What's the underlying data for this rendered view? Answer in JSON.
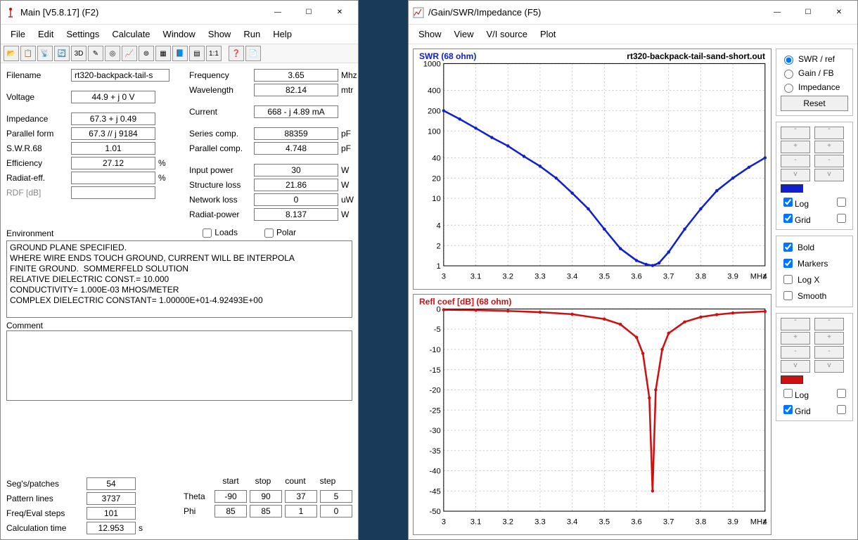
{
  "main": {
    "title": "Main  [V5.8.17]  (F2)",
    "icon": "antenna-icon",
    "winbtns": {
      "min": "—",
      "max": "☐",
      "close": "✕"
    },
    "menu": [
      "File",
      "Edit",
      "Settings",
      "Calculate",
      "Window",
      "Show",
      "Run",
      "Help"
    ],
    "toolbar_icons": [
      "open",
      "copy",
      "antenna",
      "refresh",
      "3d",
      "edit",
      "circle",
      "chart",
      "target",
      "mesh",
      "book",
      "grid",
      "ratio",
      "|",
      "help",
      "sheet"
    ],
    "filename_label": "Filename",
    "filename": "rt320-backpack-tail-s",
    "left_block": [
      {
        "label": "Voltage",
        "value": "44.9 + j 0 V",
        "unit": ""
      },
      {
        "label": "Impedance",
        "value": "67.3 + j 0.49",
        "unit": ""
      },
      {
        "label": "Parallel form",
        "value": "67.3 // j 9184",
        "unit": ""
      },
      {
        "label": "S.W.R.68",
        "value": "1.01",
        "unit": ""
      },
      {
        "label": "Efficiency",
        "value": "27.12",
        "unit": "%"
      },
      {
        "label": "Radiat-eff.",
        "value": "",
        "unit": "%"
      },
      {
        "label": "RDF [dB]",
        "value": "",
        "unit": "",
        "dim": true
      }
    ],
    "right_block": [
      {
        "label": "Frequency",
        "value": "3.65",
        "unit": "Mhz"
      },
      {
        "label": "Wavelength",
        "value": "82.14",
        "unit": "mtr"
      },
      {
        "label": "Current",
        "value": "668 - j 4.89 mA",
        "unit": ""
      },
      {
        "label": "Series comp.",
        "value": "88359",
        "unit": "pF"
      },
      {
        "label": "Parallel comp.",
        "value": "4.748",
        "unit": "pF"
      },
      {
        "label": "Input power",
        "value": "30",
        "unit": "W"
      },
      {
        "label": "Structure loss",
        "value": "21.86",
        "unit": "W"
      },
      {
        "label": "Network loss",
        "value": "0",
        "unit": "uW"
      },
      {
        "label": "Radiat-power",
        "value": "8.137",
        "unit": "W"
      }
    ],
    "checks": {
      "loads": "Loads",
      "polar": "Polar"
    },
    "env_label": "Environment",
    "environment": "GROUND PLANE SPECIFIED.\nWHERE WIRE ENDS TOUCH GROUND, CURRENT WILL BE INTERPOLA\nFINITE GROUND.  SOMMERFELD SOLUTION\nRELATIVE DIELECTRIC CONST.= 10.000\nCONDUCTIVITY= 1.000E-03 MHOS/METER\nCOMPLEX DIELECTRIC CONSTANT= 1.00000E+01-4.92493E+00",
    "comment_label": "Comment",
    "comment": "",
    "bottom_left": [
      {
        "label": "Seg's/patches",
        "value": "54"
      },
      {
        "label": "Pattern lines",
        "value": "3737"
      },
      {
        "label": "Freq/Eval steps",
        "value": "101"
      },
      {
        "label": "Calculation time",
        "value": "12.953",
        "unit": "s"
      }
    ],
    "bottom_hdr": [
      "start",
      "stop",
      "count",
      "step"
    ],
    "bottom_right": [
      {
        "label": "Theta",
        "vals": [
          "-90",
          "90",
          "37",
          "5"
        ]
      },
      {
        "label": "Phi",
        "vals": [
          "85",
          "85",
          "1",
          "0"
        ]
      }
    ]
  },
  "graph": {
    "title": "/Gain/SWR/Impedance (F5)",
    "icon": "chart-icon",
    "winbtns": {
      "min": "—",
      "max": "☐",
      "close": "✕"
    },
    "menu": [
      "Show",
      "View",
      "V/I source",
      "Plot"
    ],
    "file": "rt320-backpack-tail-sand-short.out",
    "swr_label": "SWR  (68 ohm)",
    "refl_label": "Refl coef [dB] (68 ohm)",
    "xunit": "MHz",
    "side": {
      "mode": {
        "swr": "SWR / ref",
        "gain": "Gain / FB",
        "imp": "Impedance",
        "selected": "swr"
      },
      "reset": "Reset",
      "spin_labels": [
        "ˆ",
        "+",
        "-",
        "v"
      ],
      "log": "Log",
      "grid": "Grid",
      "checks1": {
        "log": true,
        "grid": true,
        "log2": false,
        "grid2": false
      },
      "bold": "Bold",
      "markers": "Markers",
      "logx": "Log X",
      "smooth": "Smooth",
      "checks2": {
        "bold": true,
        "markers": true,
        "logx": false,
        "smooth": false
      },
      "checks3": {
        "log": false,
        "grid": true,
        "log2": false,
        "grid2": false
      }
    }
  },
  "chart_data": [
    {
      "type": "line",
      "title": "SWR (68 ohm)",
      "xlabel": "MHz",
      "ylabel": "SWR",
      "xlim": [
        3.0,
        4.0
      ],
      "ylim": [
        1,
        1000
      ],
      "yscale": "log",
      "x": [
        3.0,
        3.05,
        3.1,
        3.15,
        3.2,
        3.25,
        3.3,
        3.35,
        3.4,
        3.45,
        3.5,
        3.55,
        3.6,
        3.63,
        3.65,
        3.67,
        3.7,
        3.75,
        3.8,
        3.85,
        3.9,
        3.95,
        4.0
      ],
      "series": [
        {
          "name": "SWR",
          "color": "#1020d0",
          "values": [
            200,
            150,
            110,
            80,
            60,
            42,
            30,
            20,
            12,
            7,
            3.5,
            1.8,
            1.2,
            1.05,
            1.01,
            1.1,
            1.6,
            3.5,
            7,
            13,
            20,
            29,
            40
          ]
        }
      ]
    },
    {
      "type": "line",
      "title": "Refl coef [dB] (68 ohm)",
      "xlabel": "MHz",
      "ylabel": "dB",
      "xlim": [
        3.0,
        4.0
      ],
      "ylim": [
        -50,
        0
      ],
      "x": [
        3.0,
        3.1,
        3.2,
        3.3,
        3.4,
        3.5,
        3.55,
        3.6,
        3.62,
        3.64,
        3.65,
        3.66,
        3.68,
        3.7,
        3.75,
        3.8,
        3.85,
        3.9,
        4.0
      ],
      "series": [
        {
          "name": "Refl",
          "color": "#d01010",
          "values": [
            -0.2,
            -0.3,
            -0.5,
            -0.8,
            -1.3,
            -2.5,
            -3.8,
            -7,
            -11,
            -22,
            -45,
            -20,
            -10,
            -6,
            -3.2,
            -2.0,
            -1.4,
            -1.0,
            -0.6
          ]
        }
      ]
    }
  ]
}
